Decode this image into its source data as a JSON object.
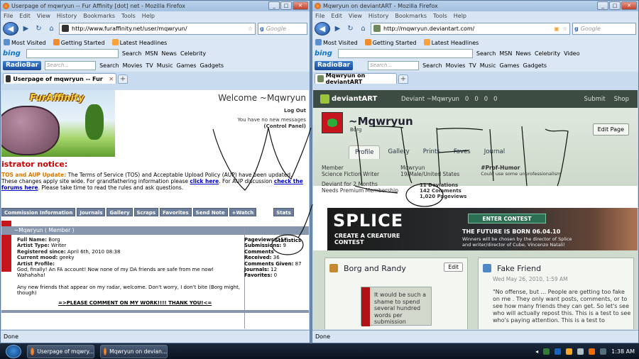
{
  "left_window": {
    "title": "Userpage of mqwryun -- Fur Affinity [dot] net - Mozilla Firefox",
    "menu": [
      "File",
      "Edit",
      "View",
      "History",
      "Bookmarks",
      "Tools",
      "Help"
    ],
    "url": "http://www.furaffinity.net/user/mqwryun/",
    "search_placeholder": "Google",
    "bookmarks": [
      "Most Visited",
      "Getting Started",
      "Latest Headlines"
    ],
    "bing": {
      "logo": "bing",
      "search": "Search",
      "items": [
        "MSN",
        "News",
        "Celebrity"
      ]
    },
    "radiobar": {
      "logo": "RadioBar",
      "search_placeholder": "Search...",
      "search": "Search",
      "items": [
        "Movies",
        "TV",
        "Music",
        "Games",
        "Gadgets"
      ]
    },
    "tab": "Userpage of mqwryun -- Fur Affinity ...",
    "status": "Done"
  },
  "fa_page": {
    "logo": "FurAffinity",
    "welcome": "Welcome ~Mqwryun",
    "logout": "Log Out",
    "messages": "You have no new messages",
    "control_panel": "(Control Panel)",
    "notice_title": "istrator notice:",
    "notice_lead": "TOS and AUP Update:",
    "notice_text1": " The Terms of Service (TOS) and Acceptable Upload Policy (AUP) have been updated.",
    "notice_text2": "These changes apply site wide. For grandfathering information please ",
    "notice_link1": "click here",
    "notice_text3": ". For AUP discussion ",
    "notice_link2": "check the",
    "notice_link3": "forums here",
    "notice_text4": ". Please take time to read the rules and ask questions.",
    "nav": [
      "Commission Information",
      "Journals",
      "Gallery",
      "Scraps",
      "Favorites",
      "Send Note",
      "+Watch"
    ],
    "nav_stats": "Stats",
    "userbar": "~Mqwryun ( Member )",
    "profile": [
      {
        "k": "Full Name:",
        "v": " Borg"
      },
      {
        "k": "Artist Type:",
        "v": " Writer"
      },
      {
        "k": "Registered since:",
        "v": " April 6th, 2010 08:38"
      },
      {
        "k": "Current mood:",
        "v": " geeky"
      },
      {
        "k": "Artist Profile:",
        "v": ""
      }
    ],
    "bio1": "God, finally! An FA account! Now none of my DA friends are safe from me now! Wahahaha!",
    "bio2": "Any new friends that appear on my radar, welcome. Don't worry, I don't bite (Borg might, though)",
    "comment_link": "=>PLEASE COMMENT ON MY WORK!!!! THANK YOU!<=",
    "stats_title": "Statistics",
    "stats": [
      {
        "k": "Pageviews:",
        "v": " 157"
      },
      {
        "k": "Submissions:",
        "v": " 9"
      },
      {
        "k": "Comments Received:",
        "v": " 36"
      },
      {
        "k": "Comments Given:",
        "v": " 87"
      },
      {
        "k": "Journals:",
        "v": " 12"
      },
      {
        "k": "Favorites:",
        "v": " 0"
      }
    ]
  },
  "right_window": {
    "title": "Mqwryun on deviantART - Mozilla Firefox",
    "menu": [
      "File",
      "Edit",
      "View",
      "History",
      "Bookmarks",
      "Tools",
      "Help"
    ],
    "url": "http://mqwryun.deviantart.com/",
    "search_placeholder": "Google",
    "bookmarks": [
      "Most Visited",
      "Getting Started",
      "Latest Headlines"
    ],
    "bing": {
      "logo": "bing",
      "search": "Search",
      "items": [
        "MSN",
        "News",
        "Celebrity",
        "Video"
      ]
    },
    "radiobar": {
      "logo": "RadioBar",
      "search_placeholder": "Search...",
      "search": "Search",
      "items": [
        "Movies",
        "TV",
        "Music",
        "Games",
        "Gadgets"
      ]
    },
    "tab": "Mqwryun on deviantART",
    "status": "Done"
  },
  "da_page": {
    "logo": "deviantART",
    "user_menu": "Deviant ~Mqwryun",
    "counts": [
      "0",
      "0",
      "0",
      "0"
    ],
    "submit": "Submit",
    "shop": "Shop",
    "name": "~Mqwryun",
    "tagline": "Borg",
    "edit_page": "Edit Page",
    "tabs": [
      "Profile",
      "Gallery",
      "Prints",
      "Faves",
      "Journal"
    ],
    "member": "Member",
    "member_type": "Science Fiction Writer",
    "username": "Mqwryun",
    "demographic": "19/Male/United States",
    "badge": "#Prof-Humor",
    "badge_sub": "Could use some unprofessionalism",
    "deviant_for": "Deviant for 2 Months",
    "premium": "Needs Premium Membership",
    "deviations": "11 Deviations",
    "comments": "142 Comments",
    "pageviews": "1,020 Pageviews",
    "ad": {
      "title": "SPLICE",
      "sub1": "CREATE A CREATURE",
      "sub2": "CONTEST",
      "button": "ENTER CONTEST",
      "future": "THE FUTURE IS BORN 06.04.10",
      "winners1": "Winners will be chosen by the director of Splice",
      "winners2": "and writer/director of Cube, Vincenzo Natali!"
    },
    "box1_title": "Borg and Randy",
    "box1_edit": "Edit",
    "box1_deviation": "It would be such a shame to spend several hundred words per submission",
    "box2_title": "Fake Friend",
    "box2_date": "Wed May 26, 2010, 1:59 AM",
    "box2_text": "\"No offense, but ... People are getting too fake on me . They only want posts, comments, or to see how many friends they can get. So let's see who will actually repost this. This is a test to see who's paying attention. This is a test to"
  },
  "taskbar": {
    "items": [
      "Userpage of mqwry...",
      "Mqwryun on devian..."
    ],
    "clock": "1:38 AM"
  },
  "colors": {
    "fa_notice": "#c40000",
    "fa_nav": "#6d7f9a",
    "da_header": "#3d4c42",
    "da_accent": "#9cc53a",
    "taskbar": "#0a1320"
  }
}
